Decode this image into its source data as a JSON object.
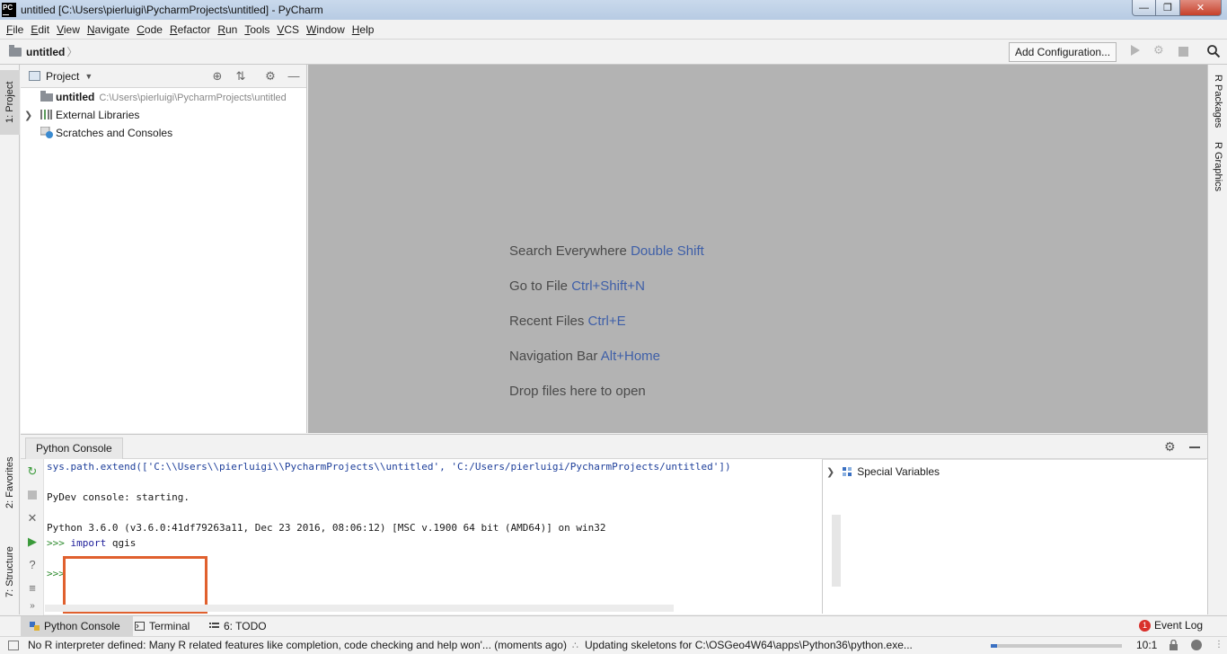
{
  "window": {
    "title": "untitled [C:\\Users\\pierluigi\\PycharmProjects\\untitled] - PyCharm",
    "logo_text": "PC"
  },
  "menu": [
    "File",
    "Edit",
    "View",
    "Navigate",
    "Code",
    "Refactor",
    "Run",
    "Tools",
    "VCS",
    "Window",
    "Help"
  ],
  "navbar": {
    "breadcrumb": "untitled",
    "add_configuration": "Add Configuration..."
  },
  "left_strip": {
    "project_tab": "1: Project",
    "favorites_tab": "2: Favorites",
    "structure_tab": "7: Structure"
  },
  "right_strip": {
    "packages_tab": "R Packages",
    "graphics_tab": "R Graphics"
  },
  "project_panel": {
    "title": "Project",
    "tree": [
      {
        "label": "untitled",
        "path": "C:\\Users\\pierluigi\\PycharmProjects\\untitled",
        "icon": "folder-icon"
      },
      {
        "label": "External Libraries",
        "path": "",
        "icon": "library-icon"
      },
      {
        "label": "Scratches and Consoles",
        "path": "",
        "icon": "scratches-icon"
      }
    ]
  },
  "editor_hints": [
    {
      "text": "Search Everywhere",
      "key": "Double Shift"
    },
    {
      "text": "Go to File",
      "key": "Ctrl+Shift+N"
    },
    {
      "text": "Recent Files",
      "key": "Ctrl+E"
    },
    {
      "text": "Navigation Bar",
      "key": "Alt+Home"
    },
    {
      "text": "Drop files here to open",
      "key": ""
    }
  ],
  "console": {
    "tab_label": "Python Console",
    "line1": "sys.path.extend(['C:\\\\Users\\\\pierluigi\\\\PycharmProjects\\\\untitled', 'C:/Users/pierluigi/PycharmProjects/untitled'])",
    "line2": "PyDev console: starting.",
    "line3": "Python 3.6.0 (v3.6.0:41df79263a11, Dec 23 2016, 08:06:12) [MSC v.1900 64 bit (AMD64)] on win32",
    "prompt": ">>>",
    "keyword": "import",
    "module": "qgis",
    "special_variables": "Special Variables"
  },
  "bottom_tabs": {
    "python_console": "Python Console",
    "terminal": "Terminal",
    "todo": "6: TODO",
    "event_log": "Event Log",
    "event_count": "1"
  },
  "status": {
    "message": "No R interpreter defined: Many R related features like completion, code checking and help won'... (moments ago)",
    "task": "Updating skeletons for C:\\OSGeo4W64\\apps\\Python36\\python.exe...",
    "position": "10:1",
    "progress": 0.05
  },
  "colors": {
    "accent_key": "#3e5fa8",
    "highlight_box": "#e0602e",
    "event_badge": "#d9302b"
  }
}
